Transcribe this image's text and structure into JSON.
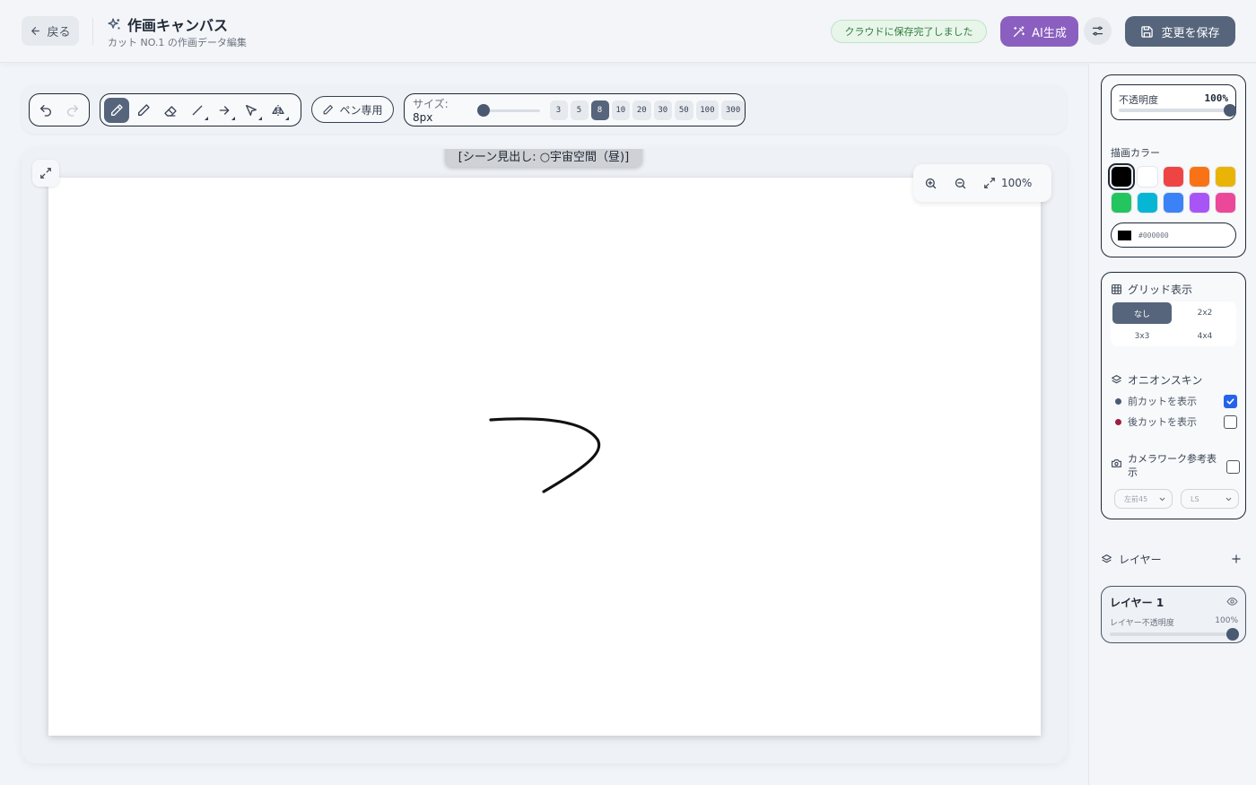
{
  "header": {
    "back_label": "戻る",
    "title": "作画キャンバス",
    "subtitle": "カット NO.1 の作画データ編集",
    "save_status": "クラウドに保存完了しました",
    "ai_label": "AI生成",
    "save_label": "変更を保存"
  },
  "toolbar": {
    "tools": [
      "brush-icon",
      "pencil-icon",
      "eraser-icon",
      "line-icon",
      "arrow-icon",
      "select-icon",
      "flip-icon"
    ],
    "active_tool": "brush",
    "pen_only_label": "ペン専用",
    "size_label": "サイズ:",
    "size_value": "8px",
    "size_presets": [
      "3",
      "5",
      "8",
      "10",
      "20",
      "30",
      "50",
      "100",
      "300"
    ],
    "active_size": "8"
  },
  "canvas": {
    "scene_label": "[シーン見出し: ○宇宙空間（昼)]",
    "zoom": "100%"
  },
  "sidebar": {
    "opacity_label": "不透明度",
    "opacity_value": "100%",
    "color_label": "描画カラー",
    "swatches": [
      "#000000",
      "#ffffff",
      "#ef4444",
      "#f97316",
      "#eab308",
      "#22c55e",
      "#06b6d4",
      "#3b82f6",
      "#a855f7",
      "#ec4899"
    ],
    "selected_color": "#000000",
    "hex_value": "#000000",
    "grid": {
      "label": "グリッド表示",
      "options": [
        "なし",
        "2x2",
        "3x3",
        "4x4"
      ],
      "active": "なし"
    },
    "onion": {
      "label": "オニオンスキン",
      "prev_label": "前カットを表示",
      "prev_checked": true,
      "next_label": "後カットを表示",
      "next_checked": false
    },
    "camera": {
      "label": "カメラワーク参考表示",
      "checked": false,
      "angle_value": "左前45",
      "shot_value": "LS"
    },
    "layers": {
      "label": "レイヤー",
      "items": [
        {
          "name": "レイヤー 1",
          "opacity_label": "レイヤー不透明度",
          "opacity_value": "100%"
        }
      ]
    }
  }
}
